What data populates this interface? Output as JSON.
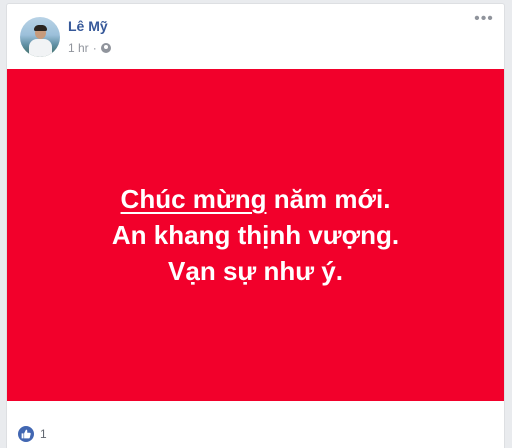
{
  "post": {
    "author": "Lê Mỹ",
    "timestamp": "1 hr",
    "separator": "·",
    "privacy_icon": "globe-icon",
    "more_icon": "more-options-icon",
    "more_label": "•••",
    "banner": {
      "background_color": "#f2002b",
      "text_color": "#ffffff",
      "line1_underlined": "Chúc mừng",
      "line1_rest": " năm mới.",
      "line2": "An khang thịnh vượng.",
      "line3": "Vạn sự như ý."
    },
    "reactions": {
      "icon": "like-icon",
      "count": "1"
    }
  },
  "colors": {
    "page_background": "#e9ebee",
    "author_link": "#365899",
    "meta_text": "#90949c",
    "like_blue": "#4267b2"
  }
}
